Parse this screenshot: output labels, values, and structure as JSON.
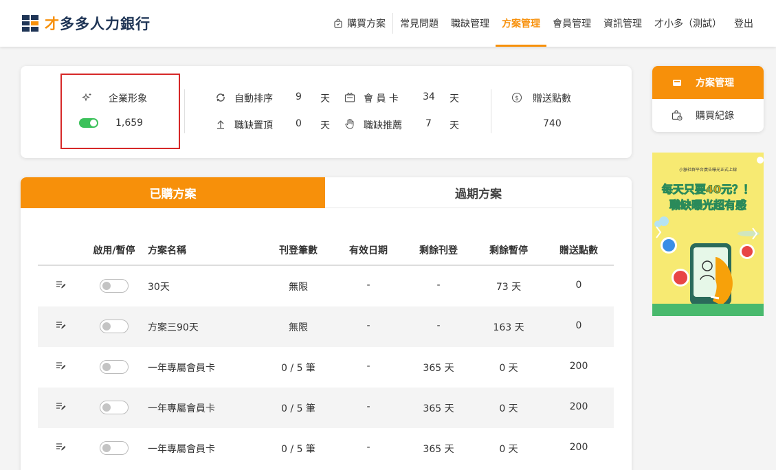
{
  "header": {
    "logo_text": "才多多人力銀行",
    "nav": [
      {
        "label": "購買方案",
        "icon": "shopping-bag-icon"
      },
      {
        "label": "常見問題"
      },
      {
        "label": "職缺管理"
      },
      {
        "label": "方案管理",
        "active": true
      },
      {
        "label": "會員管理"
      },
      {
        "label": "資訊管理"
      },
      {
        "label": "才小多（測試）"
      },
      {
        "label": "登出"
      }
    ]
  },
  "summary": {
    "brand": {
      "label": "企業形象",
      "value": "1,659",
      "icon": "sparkle-icon",
      "enabled": true
    },
    "auto_sort": {
      "label": "自動排序",
      "value": "9",
      "unit": "天",
      "icon": "sync-icon"
    },
    "member_card": {
      "label": "會 員 卡",
      "value": "34",
      "unit": "天",
      "icon": "card-icon"
    },
    "job_top": {
      "label": "職缺置頂",
      "value": "0",
      "unit": "天",
      "icon": "arrow-up-icon"
    },
    "job_recommend": {
      "label": "職缺推薦",
      "value": "7",
      "unit": "天",
      "icon": "hand-icon"
    },
    "bonus_points": {
      "label": "贈送點數",
      "value": "740",
      "icon": "coin-icon"
    }
  },
  "tabs": {
    "active": "已購方案",
    "inactive": "過期方案"
  },
  "table": {
    "headers": [
      "啟用/暫停",
      "方案名稱",
      "刊登筆數",
      "有效日期",
      "剩餘刊登",
      "剩餘暫停",
      "贈送點數"
    ],
    "rows": [
      {
        "name": "30天",
        "listings": "無限",
        "valid": "-",
        "remain_post": "-",
        "remain_pause": "73 天",
        "points": "0",
        "enabled": false
      },
      {
        "name": "方案三90天",
        "listings": "無限",
        "valid": "-",
        "remain_post": "-",
        "remain_pause": "163 天",
        "points": "0",
        "enabled": false
      },
      {
        "name": "一年專屬會員卡",
        "listings": "0 / 5 筆",
        "valid": "-",
        "remain_post": "365 天",
        "remain_pause": "0 天",
        "points": "200",
        "enabled": false
      },
      {
        "name": "一年專屬會員卡",
        "listings": "0 / 5 筆",
        "valid": "-",
        "remain_post": "365 天",
        "remain_pause": "0 天",
        "points": "200",
        "enabled": false
      },
      {
        "name": "一年專屬會員卡",
        "listings": "0 / 5 筆",
        "valid": "-",
        "remain_post": "365 天",
        "remain_pause": "0 天",
        "points": "200",
        "enabled": false
      }
    ]
  },
  "side_menu": [
    {
      "label": "方案管理",
      "icon": "wallet-icon",
      "active": true
    },
    {
      "label": "購買紀錄",
      "icon": "bag-clock-icon",
      "active": false
    }
  ],
  "ad": {
    "small_text": "小額社群平台廣告曝光正式上線",
    "line1": "每天只要40元？！",
    "line2": "職缺曝光超有感"
  },
  "colors": {
    "accent": "#f7900a",
    "brand_navy": "#1f3556",
    "toggle_on": "#3cc15b",
    "highlight_border": "#d62828"
  }
}
